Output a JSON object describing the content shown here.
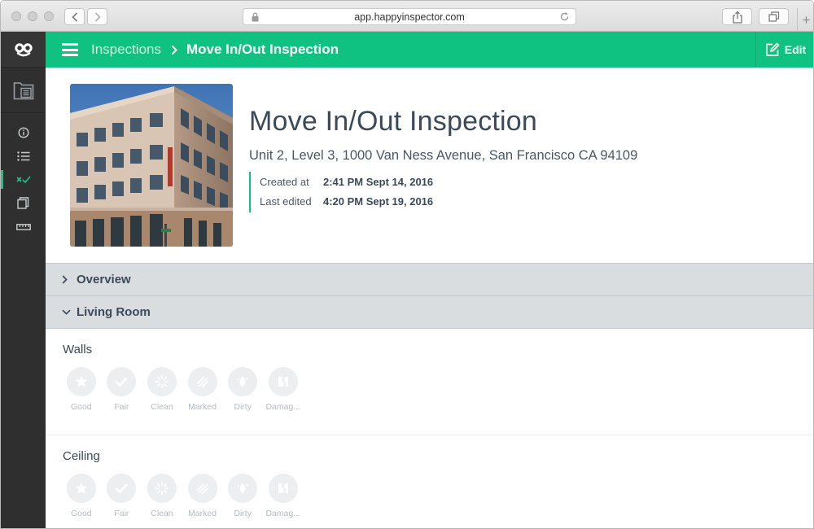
{
  "browser": {
    "url": "app.happyinspector.com",
    "plus_tab": "+"
  },
  "header": {
    "breadcrumb_parent": "Inspections",
    "breadcrumb_current": "Move In/Out Inspection",
    "edit_label": "Edit"
  },
  "inspection": {
    "title": "Move In/Out Inspection",
    "address": "Unit 2, Level 3, 1000 Van Ness Avenue, San Francisco CA 94109",
    "created_label": "Created at",
    "created_value": "2:41 PM Sept 14, 2016",
    "edited_label": "Last edited",
    "edited_value": "4:20 PM Sept 19, 2016"
  },
  "sections": [
    {
      "label": "Overview",
      "expanded": false
    },
    {
      "label": "Living Room",
      "expanded": true
    }
  ],
  "items": [
    {
      "title": "Walls"
    },
    {
      "title": "Ceiling"
    }
  ],
  "ratings": [
    {
      "label": "Good",
      "icon": "star-icon"
    },
    {
      "label": "Fair",
      "icon": "check-icon"
    },
    {
      "label": "Clean",
      "icon": "sparkle-icon"
    },
    {
      "label": "Marked",
      "icon": "marked-icon"
    },
    {
      "label": "Dirty",
      "icon": "dirt-icon"
    },
    {
      "label": "Damag...",
      "icon": "damaged-icon"
    }
  ],
  "colors": {
    "brand_green": "#10c281",
    "rail_dark": "#2f2f2f",
    "section_gray": "#d9dde0"
  }
}
